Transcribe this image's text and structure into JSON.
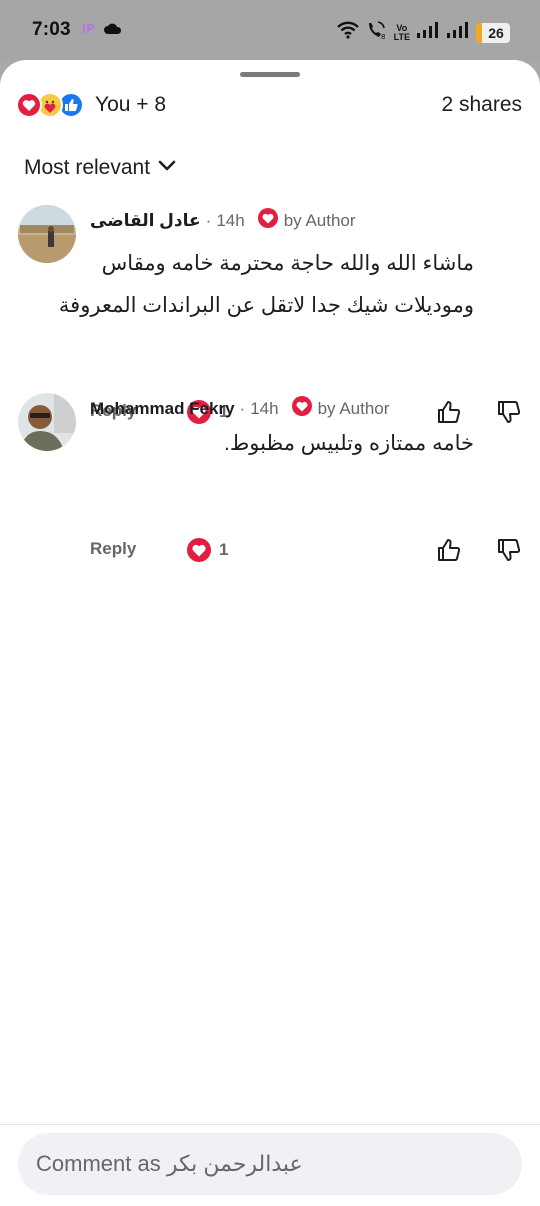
{
  "status_bar": {
    "time": "7:03",
    "left_icons": [
      "app-icon",
      "cloud-icon"
    ],
    "right_icons": [
      "wifi-icon",
      "call-icon",
      "volte-icon",
      "signal-icon",
      "signal-icon"
    ],
    "volte_label": "Vo LTE",
    "battery": "26"
  },
  "reactions": {
    "icons": [
      "heart-reaction-icon",
      "care-reaction-icon",
      "like-reaction-icon"
    ],
    "summary": "You + 8",
    "shares": "2 shares"
  },
  "sort": {
    "label": "Most relevant"
  },
  "comments": [
    {
      "name": "عادل القاضى",
      "time": "14h",
      "badge": "by Author",
      "lines": [
        "ماشاء الله والله حاجة محترمة خامه ومقاس",
        "وموديلات شيك جدا لاتقل عن البراندات المعروفة"
      ],
      "reply": "Reply",
      "likes": "1"
    },
    {
      "name": "Mohammad Fekry",
      "time": "14h",
      "badge": "by Author",
      "lines": [
        "خامه ممتازه وتلبيس مظبوط."
      ],
      "reply": "Reply",
      "likes": "1"
    }
  ],
  "composer": {
    "placeholder": "Comment as عبدالرحمن بكر"
  },
  "colors": {
    "heart": "#e41e3f",
    "like": "#1877f2",
    "secondary_text": "#65676b"
  }
}
